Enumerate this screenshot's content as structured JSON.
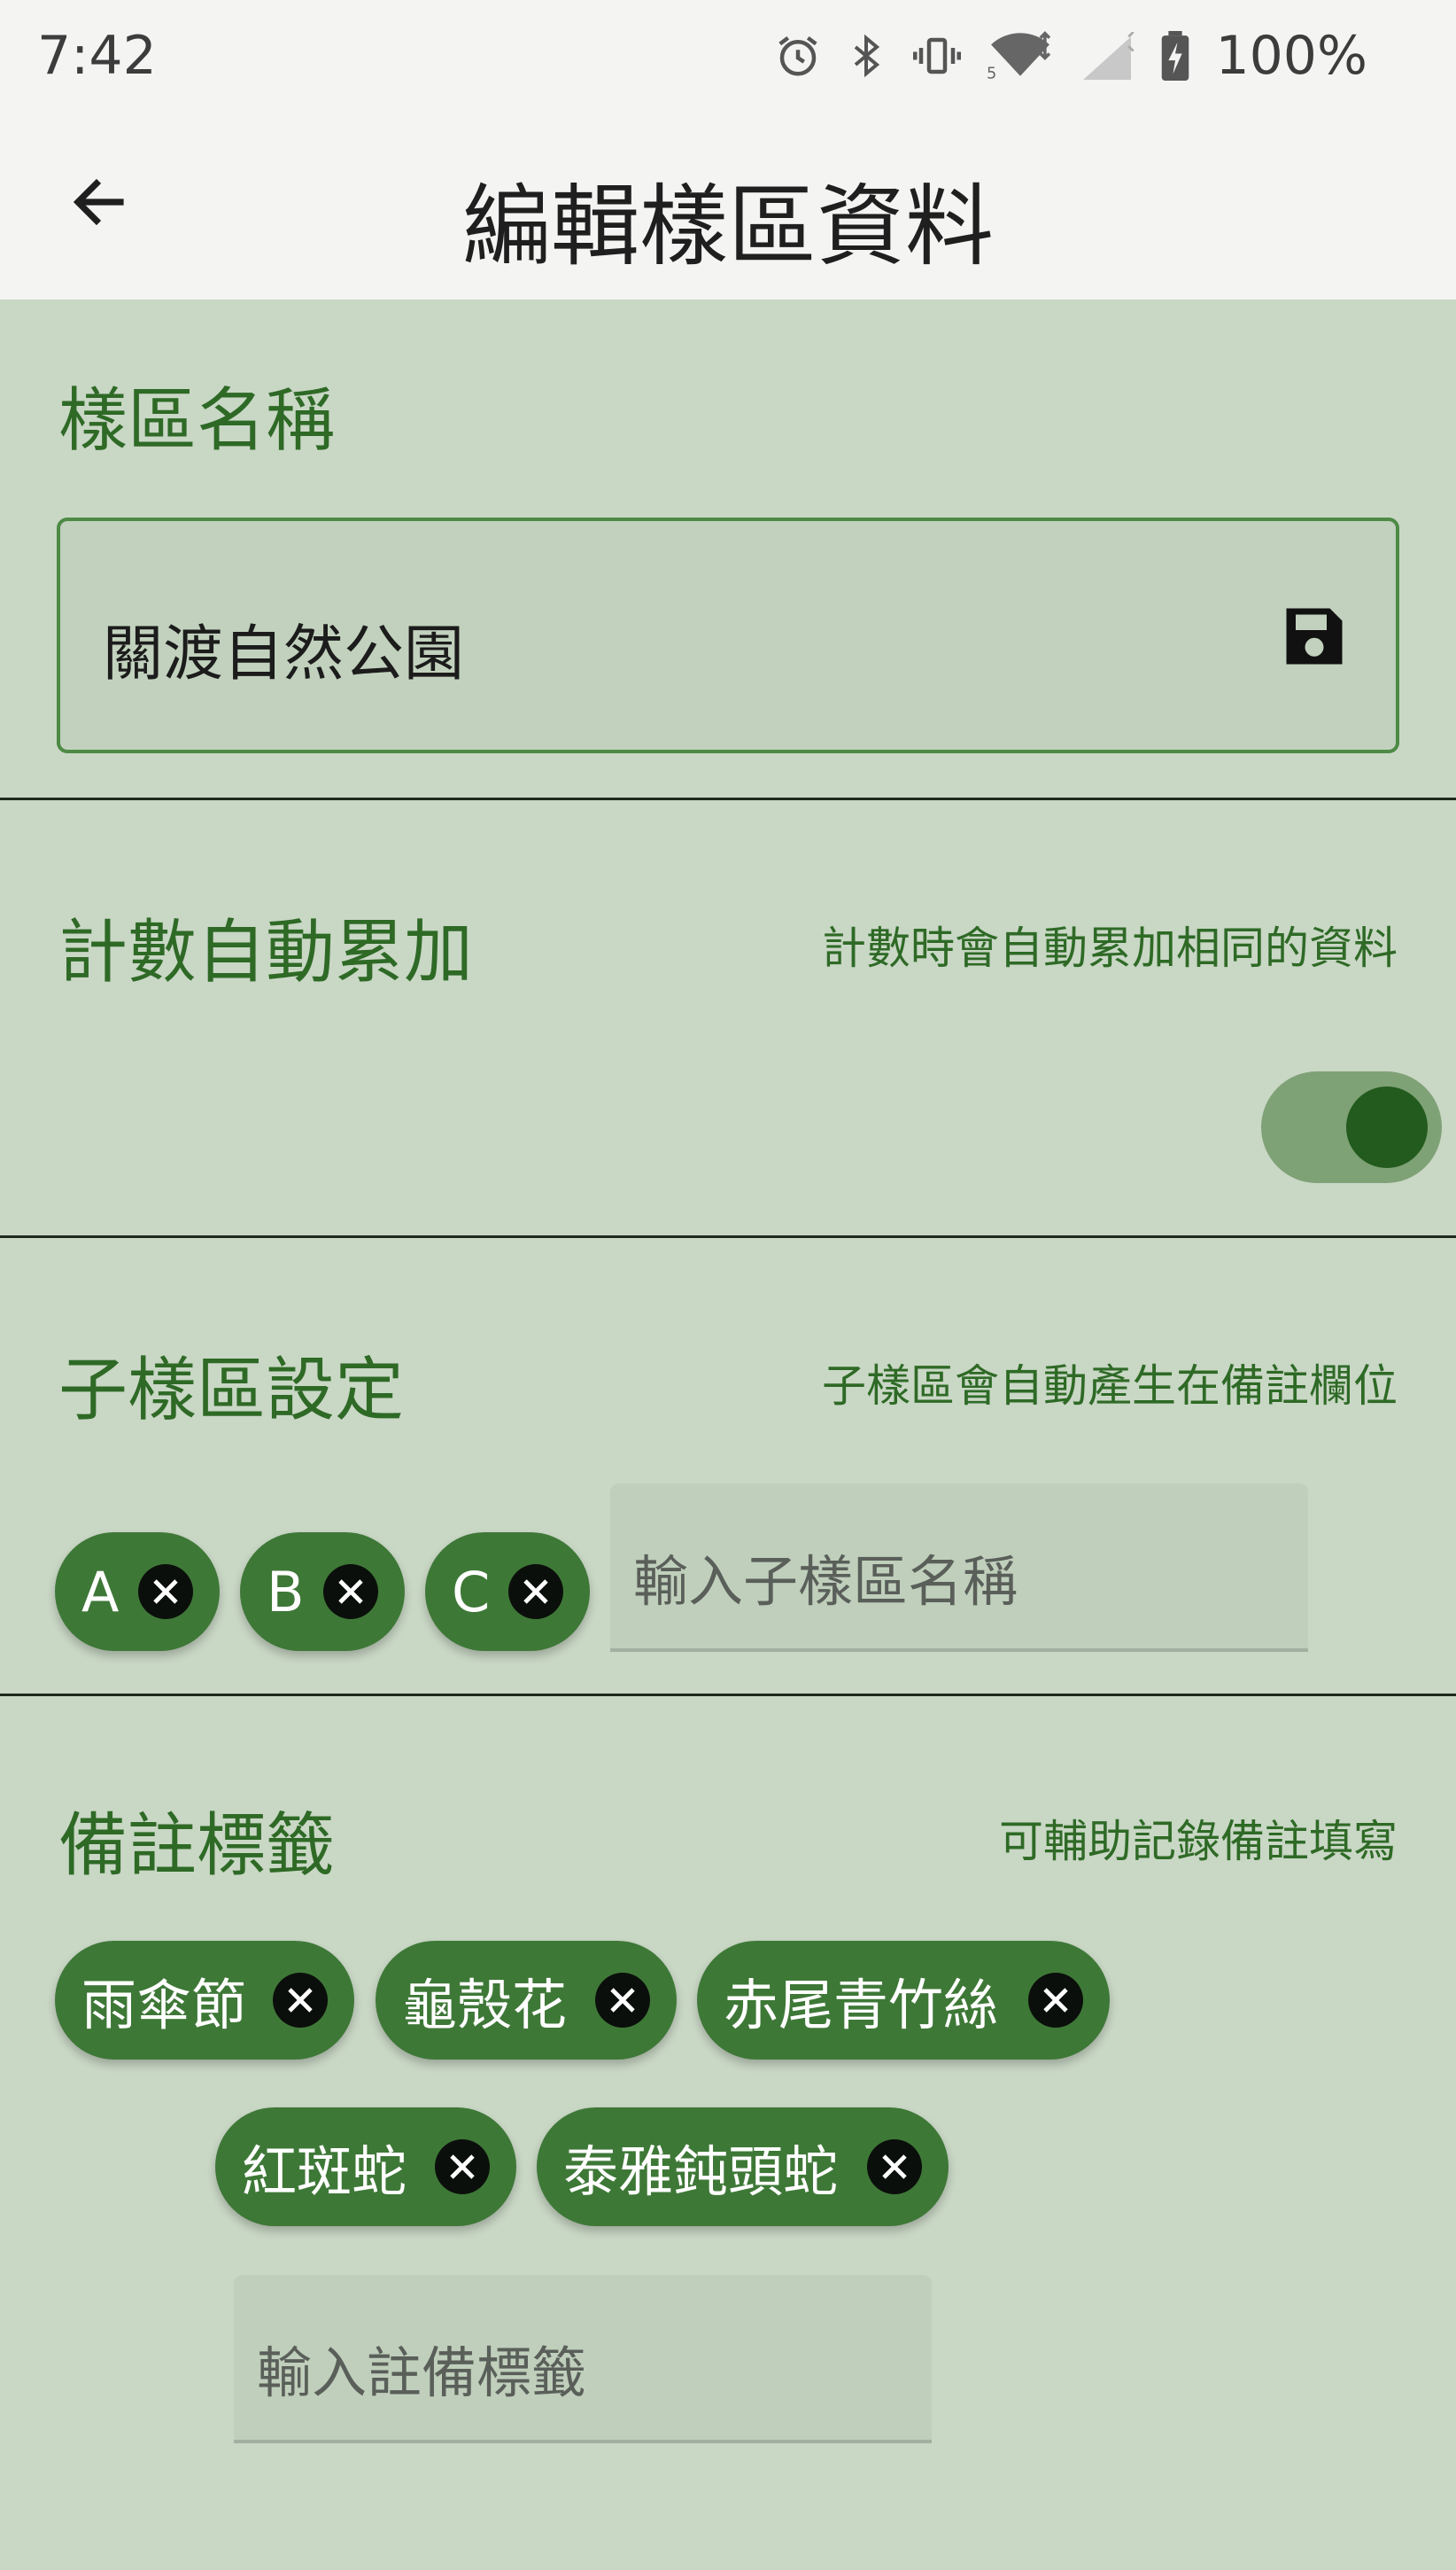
{
  "status_bar": {
    "time": "7:42",
    "icons": [
      "alarm-icon",
      "bluetooth-icon",
      "vibrate-icon",
      "wifi-icon",
      "signal-icon",
      "battery-charging-icon"
    ],
    "battery": "100%"
  },
  "app_bar": {
    "back_icon": "arrow-back-icon",
    "title": "編輯樣區資料"
  },
  "plot_name": {
    "title": "樣區名稱",
    "value": "關渡自然公園",
    "save_icon": "save-icon"
  },
  "auto_accumulate": {
    "title": "計數自動累加",
    "hint": "計數時會自動累加相同的資料",
    "enabled": true
  },
  "sub_plots": {
    "title": "子樣區設定",
    "hint": "子樣區會自動產生在備註欄位",
    "chips": [
      {
        "label": "A"
      },
      {
        "label": "B"
      },
      {
        "label": "C"
      }
    ],
    "input_placeholder": "輸入子樣區名稱"
  },
  "note_tags": {
    "title": "備註標籤",
    "hint": "可輔助記錄備註填寫",
    "chips": [
      {
        "label": "雨傘節"
      },
      {
        "label": "龜殼花"
      },
      {
        "label": "赤尾青竹絲"
      },
      {
        "label": "紅斑蛇"
      },
      {
        "label": "泰雅鈍頭蛇"
      }
    ],
    "input_placeholder": "輸入註備標籤"
  },
  "colors": {
    "accent": "#2e6a26",
    "chip": "#3e7837",
    "background": "#c9d7c5",
    "bar": "#f4f5f3"
  }
}
